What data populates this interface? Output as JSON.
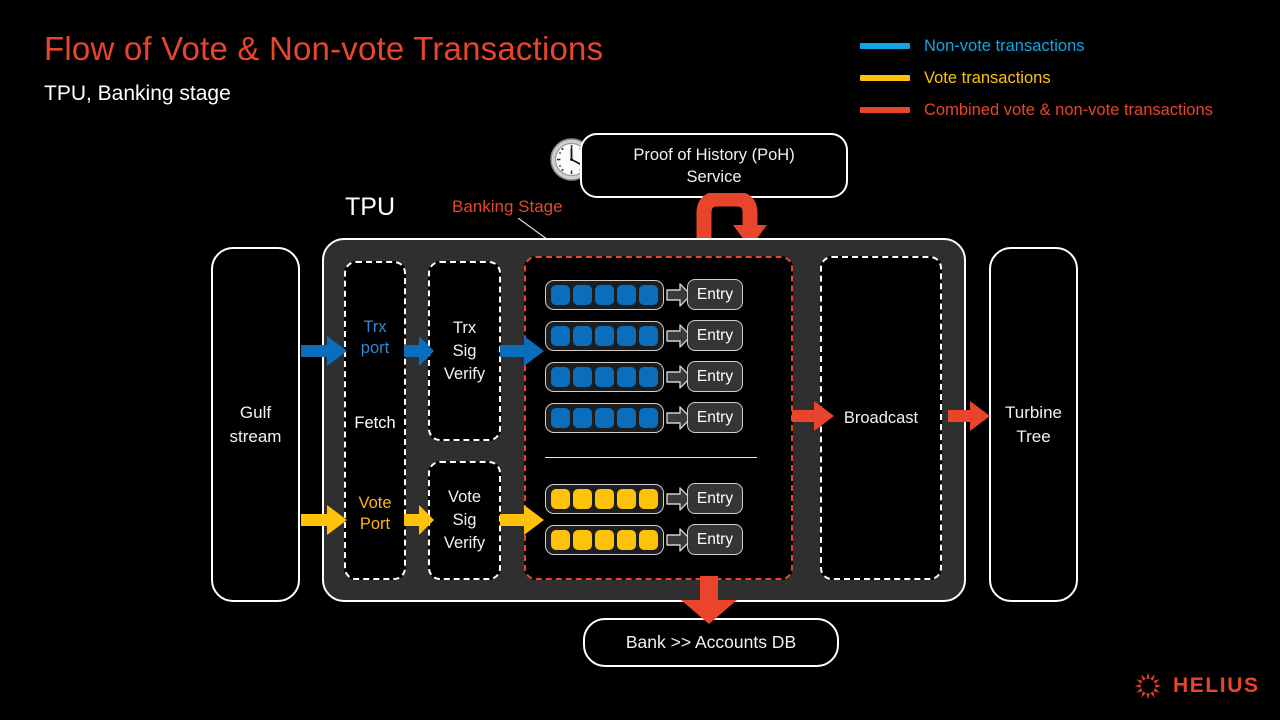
{
  "header": {
    "title": "Flow of Vote & Non-vote Transactions",
    "subtitle": "TPU, Banking stage"
  },
  "legend": {
    "items": [
      {
        "label": "Non-vote transactions",
        "color": "#12a5e5"
      },
      {
        "label": "Vote transactions",
        "color": "#ffc20a"
      },
      {
        "label": "Combined vote & non-vote transactions",
        "color": "#e8452c"
      }
    ]
  },
  "diagram": {
    "poh": {
      "label": "Proof of History (PoH)\nService",
      "line1": "Proof of History (PoH)",
      "line2": "Service",
      "icon": "clock-icon"
    },
    "tpu_label": "TPU",
    "banking_stage_label": "Banking Stage",
    "gulf_stream": {
      "line1": "Gulf",
      "line2": "stream"
    },
    "fetch": {
      "trx_port": "Trx\nport",
      "trx_port_l1": "Trx",
      "trx_port_l2": "port",
      "fetch_label": "Fetch",
      "vote_port_l1": "Vote",
      "vote_port_l2": "Port"
    },
    "trx_sig_verify": "Trx\nSig\nVerify",
    "vote_sig_verify": "Vote\nSig\nVerify",
    "broadcast": "Broadcast",
    "turbine_tree": {
      "line1": "Turbine",
      "line2": "Tree"
    },
    "bank": "Bank >> Accounts DB",
    "entry_label": "Entry",
    "batches": {
      "nonvote": [
        {
          "cells": 5,
          "color": "#0a6ebd",
          "entry": "Entry"
        },
        {
          "cells": 5,
          "color": "#0a6ebd",
          "entry": "Entry"
        },
        {
          "cells": 5,
          "color": "#0a6ebd",
          "entry": "Entry"
        },
        {
          "cells": 5,
          "color": "#0a6ebd",
          "entry": "Entry"
        }
      ],
      "vote": [
        {
          "cells": 5,
          "color": "#ffc20a",
          "entry": "Entry"
        },
        {
          "cells": 5,
          "color": "#ffc20a",
          "entry": "Entry"
        }
      ]
    }
  },
  "colors": {
    "accent_red": "#e8452c",
    "blue": "#0a6ebd",
    "legend_blue": "#12a5e5",
    "yellow": "#ffc20a",
    "trx_port_text": "#2f86d6",
    "vote_port_text": "#ffb511",
    "tpu_bg": "#2f2f2f",
    "background": "#000000"
  },
  "branding": {
    "name": "HELIUS",
    "logo_icon": "helius-sun-icon"
  }
}
